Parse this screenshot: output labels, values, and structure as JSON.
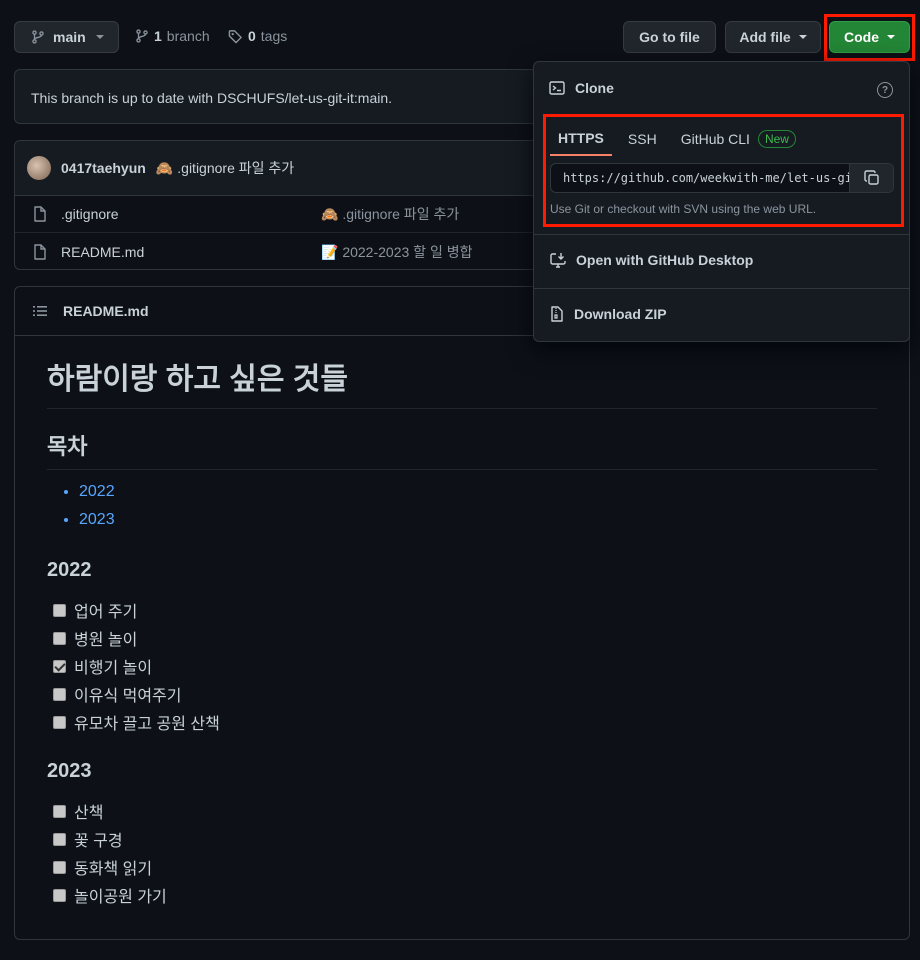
{
  "topbar": {
    "branch": "main",
    "branches_count": "1",
    "branches_label": "branch",
    "tags_count": "0",
    "tags_label": "tags",
    "go_to_file": "Go to file",
    "add_file": "Add file",
    "code": "Code"
  },
  "status": {
    "message": "This branch is up to date with DSCHUFS/let-us-git-it:main."
  },
  "latest_commit": {
    "author": "0417taehyun",
    "emoji": "🙈",
    "message": ".gitignore 파일 추가"
  },
  "files": [
    {
      "name": ".gitignore",
      "emoji": "🙈",
      "message": ".gitignore 파일 추가"
    },
    {
      "name": "README.md",
      "emoji": "📝",
      "message": "2022-2023 할 일 병합"
    }
  ],
  "readme": {
    "filename": "README.md",
    "title": "하람이랑 하고 싶은 것들",
    "toc_heading": "목차",
    "toc": [
      "2022",
      "2023"
    ],
    "sections": [
      {
        "heading": "2022",
        "tasks": [
          {
            "label": "업어 주기",
            "checked": false
          },
          {
            "label": "병원 놀이",
            "checked": false
          },
          {
            "label": "비행기 놀이",
            "checked": true
          },
          {
            "label": "이유식 먹여주기",
            "checked": false
          },
          {
            "label": "유모차 끌고 공원 산책",
            "checked": false
          }
        ]
      },
      {
        "heading": "2023",
        "tasks": [
          {
            "label": "산책",
            "checked": false
          },
          {
            "label": "꽃 구경",
            "checked": false
          },
          {
            "label": "동화책 읽기",
            "checked": false
          },
          {
            "label": "놀이공원 가기",
            "checked": false
          }
        ]
      }
    ]
  },
  "clone_dropdown": {
    "title": "Clone",
    "tabs": [
      "HTTPS",
      "SSH",
      "GitHub CLI"
    ],
    "active_tab": "HTTPS",
    "new_badge": "New",
    "url": "https://github.com/weekwith-me/let-us-git-it.git",
    "hint": "Use Git or checkout with SVN using the web URL.",
    "open_desktop": "Open with GitHub Desktop",
    "download_zip": "Download ZIP"
  },
  "colors": {
    "background": "#0d1117",
    "panel": "#161b22",
    "border": "#30363d",
    "accent_green": "#238636",
    "link_blue": "#58a6ff",
    "active_tab_underline": "#f78166",
    "highlight_red": "#ff1a00"
  },
  "icons": [
    "git-branch-icon",
    "tag-icon",
    "terminal-icon",
    "question-icon",
    "copy-icon",
    "desktop-download-icon",
    "file-zip-icon",
    "file-icon",
    "list-icon"
  ]
}
